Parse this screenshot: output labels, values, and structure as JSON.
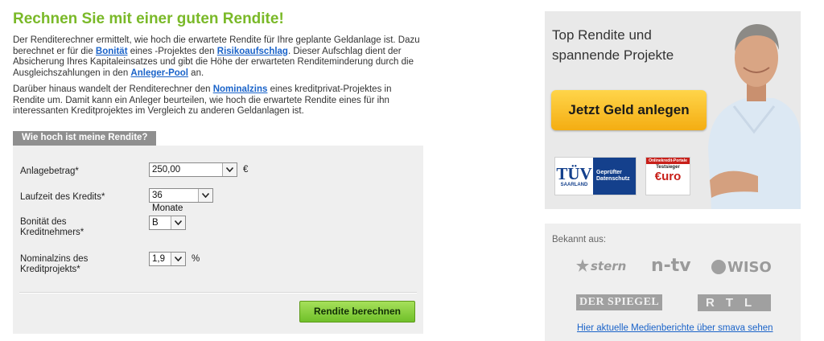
{
  "headline": "Rechnen Sie mit einer guten Rendite!",
  "intro": {
    "p1_a": "Der Renditerechner ermittelt, wie hoch die erwartete Rendite für Ihre geplante Geldanlage ist. Dazu berechnet er für die ",
    "p1_link1": "Bonität",
    "p1_b": " eines -Projektes den ",
    "p1_link2": "Risikoaufschlag",
    "p1_c": ". Dieser Aufschlag dient der Absicherung Ihres Kapitaleinsatzes und gibt die Höhe der erwarteten Renditeminderung durch die Ausgleichszahlungen in den ",
    "p1_link3": "Anleger-Pool",
    "p1_d": " an.",
    "p2_a": "Darüber hinaus wandelt der Renditerechner den ",
    "p2_link": "Nominalzins",
    "p2_b": " eines kreditprivat-Projektes in Rendite um. Damit kann ein Anleger beurteilen, wie hoch die erwartete Rendite eines für ihn interessanten Kreditprojektes im Vergleich zu anderen Geldanlagen ist."
  },
  "calculator": {
    "tab_label": "Wie hoch ist meine Rendite?",
    "fields": [
      {
        "label": "Anlagebetrag*",
        "value": "250,00",
        "unit": "€"
      },
      {
        "label": "Laufzeit des Kredits*",
        "value": "36 Monate",
        "unit": ""
      },
      {
        "label": "Bonität des Kreditnehmers*",
        "value": "B",
        "unit": ""
      },
      {
        "label": "Nominalzins des Kreditprojekts*",
        "value": "1,9",
        "unit": "%"
      }
    ],
    "submit_label": "Rendite berechnen"
  },
  "ad": {
    "title_line1": "Top Rendite und",
    "title_line2": "spannende Projekte",
    "cta_label": "Jetzt Geld anlegen",
    "tuv_main": "TÜV",
    "tuv_sub": "SAARLAND",
    "tuv_text1": "Geprüfter",
    "tuv_text2": "Datenschutz",
    "euro_header": "Onlinekredit-Portale",
    "euro_badge": "Testsieger",
    "euro_logo": "€uro"
  },
  "press": {
    "title": "Bekannt aus:",
    "logos": [
      "stern",
      "n-tv",
      "WISO",
      "DER SPIEGEL",
      "RTL"
    ],
    "link_label": "Hier aktuelle Medienberichte über smava sehen"
  },
  "colors": {
    "headline_green": "#7ab928",
    "link_blue": "#1a63c9",
    "button_green": "#70c02a",
    "cta_yellow": "#f4ad12"
  }
}
